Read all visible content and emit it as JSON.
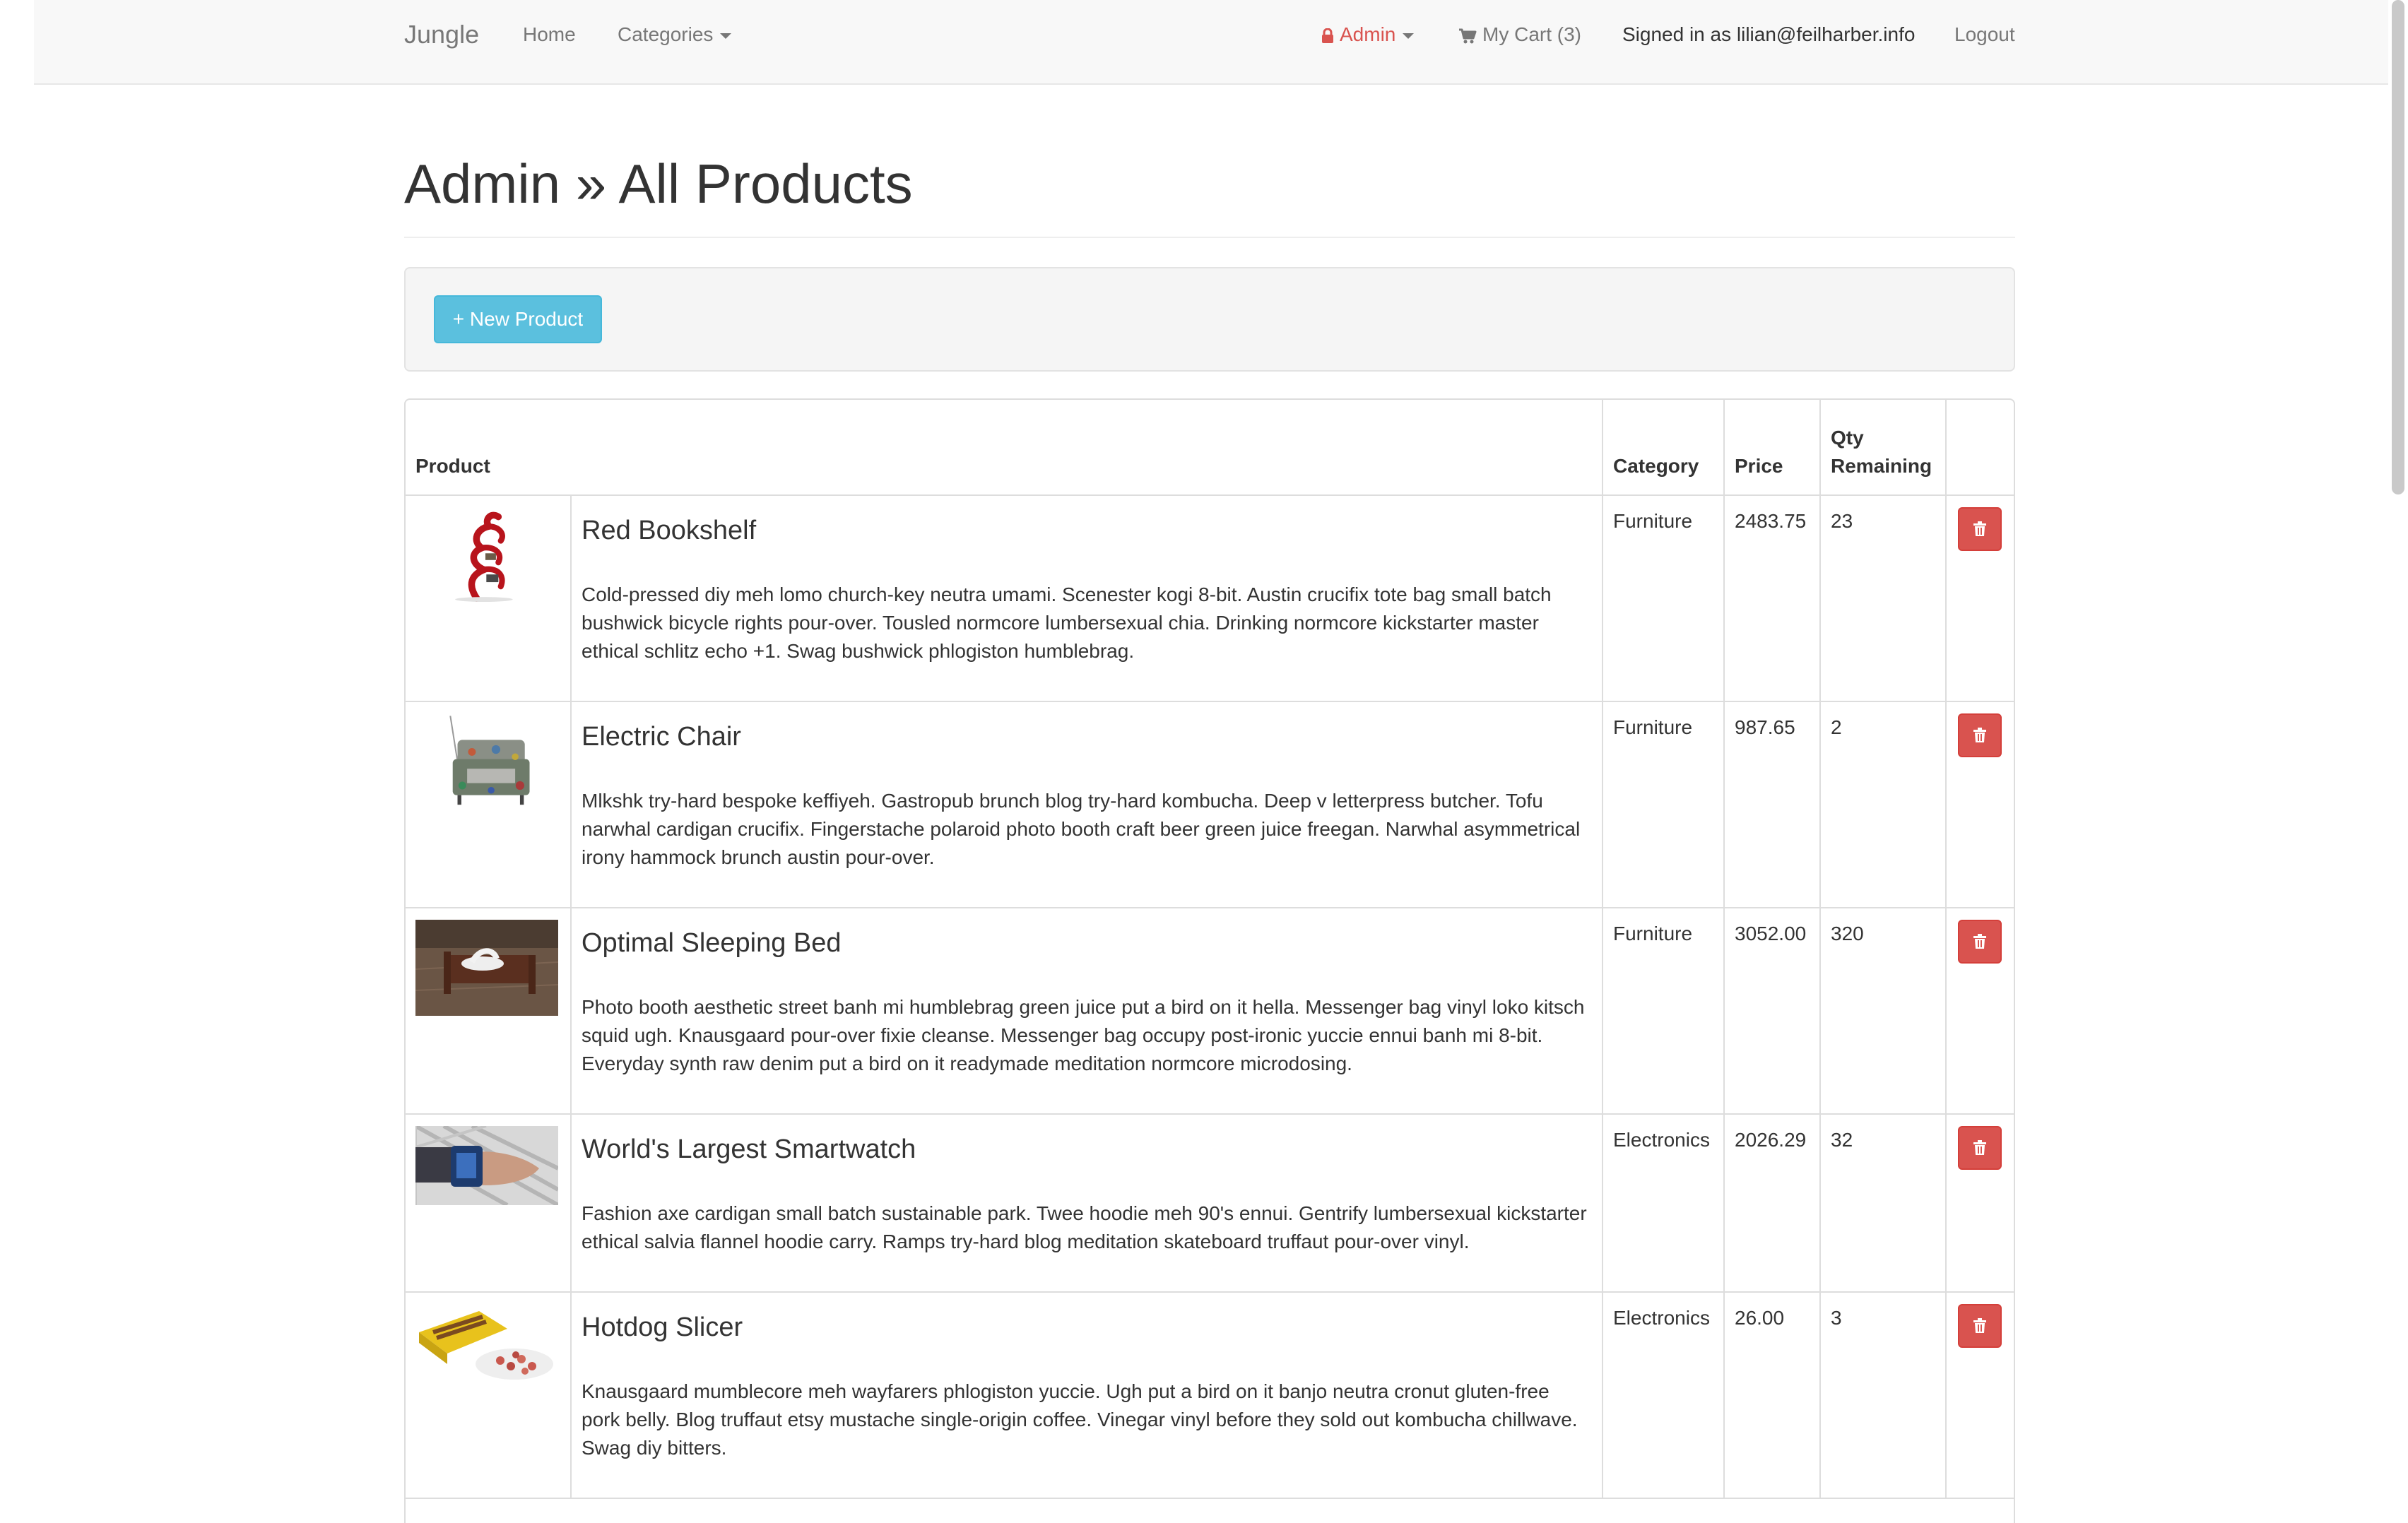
{
  "navbar": {
    "brand": "Jungle",
    "home": "Home",
    "categories": "Categories",
    "admin": "Admin",
    "cart": "My Cart (3)",
    "signed_in": "Signed in as lilian@feilharber.info",
    "logout": "Logout"
  },
  "page": {
    "title": "Admin » All Products",
    "new_product_button": "+ New Product"
  },
  "table": {
    "headers": {
      "product": "Product",
      "category": "Category",
      "price": "Price",
      "qty": "Qty Remaining"
    },
    "rows": [
      {
        "name": "Red Bookshelf",
        "description": "Cold-pressed diy meh lomo church-key neutra umami. Scenester kogi 8-bit. Austin crucifix tote bag small batch bushwick bicycle rights pour-over. Tousled normcore lumbersexual chia. Drinking normcore kickstarter master ethical schlitz echo +1. Swag bushwick phlogiston humblebrag.",
        "category": "Furniture",
        "price": "2483.75",
        "qty": "23",
        "image": "red-bookshelf-photo"
      },
      {
        "name": "Electric Chair",
        "description": "Mlkshk try-hard bespoke keffiyeh. Gastropub brunch blog try-hard kombucha. Deep v letterpress butcher. Tofu narwhal cardigan crucifix. Fingerstache polaroid photo booth craft beer green juice freegan. Narwhal asymmetrical irony hammock brunch austin pour-over.",
        "category": "Furniture",
        "price": "987.65",
        "qty": "2",
        "image": "electric-chair-photo"
      },
      {
        "name": "Optimal Sleeping Bed",
        "description": "Photo booth aesthetic street banh mi humblebrag green juice put a bird on it hella. Messenger bag vinyl loko kitsch squid ugh. Knausgaard pour-over fixie cleanse. Messenger bag occupy post-ironic yuccie ennui banh mi 8-bit. Everyday synth raw denim put a bird on it readymade meditation normcore microdosing.",
        "category": "Furniture",
        "price": "3052.00",
        "qty": "320",
        "image": "sleeping-bed-photo"
      },
      {
        "name": "World's Largest Smartwatch",
        "description": "Fashion axe cardigan small batch sustainable park. Twee hoodie meh 90's ennui. Gentrify lumbersexual kickstarter ethical salvia flannel hoodie carry. Ramps try-hard blog meditation skateboard truffaut pour-over vinyl.",
        "category": "Electronics",
        "price": "2026.29",
        "qty": "32",
        "image": "smartwatch-photo"
      },
      {
        "name": "Hotdog Slicer",
        "description": "Knausgaard mumblecore meh wayfarers phlogiston yuccie. Ugh put a bird on it banjo neutra cronut gluten-free pork belly. Blog truffaut etsy mustache single-origin coffee. Vinegar vinyl before they sold out kombucha chillwave. Swag diy bitters.",
        "category": "Electronics",
        "price": "26.00",
        "qty": "3",
        "image": "hotdog-slicer-photo"
      }
    ]
  },
  "colors": {
    "admin_red": "#d9534f",
    "info_blue": "#5bc0de",
    "navbar_bg": "#f8f8f8"
  }
}
